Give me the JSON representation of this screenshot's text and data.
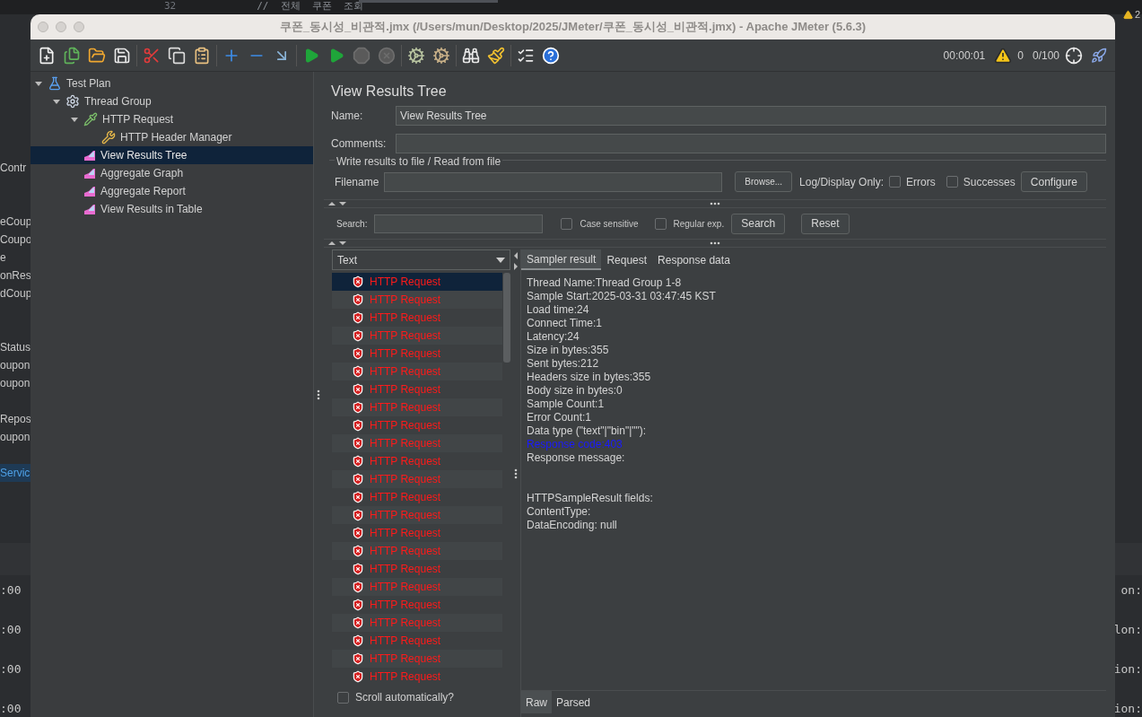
{
  "background_editor": {
    "line_number": "32",
    "code_line": "//  전체  쿠폰  조회",
    "problem_count": "2",
    "left_fragments": [
      {
        "text": "Contr",
        "selected": false
      },
      {
        "text": "eCoup",
        "selected": false
      },
      {
        "text": "Coupo",
        "selected": false
      },
      {
        "text": "e",
        "selected": false
      },
      {
        "text": "onRes",
        "selected": false
      },
      {
        "text": "dCoup",
        "selected": false
      },
      {
        "text": "Status",
        "selected": false
      },
      {
        "text": "oupon",
        "selected": false
      },
      {
        "text": "oupon",
        "selected": false
      },
      {
        "text": "Repos",
        "selected": false
      },
      {
        "text": "oupon",
        "selected": false
      },
      {
        "text": "Servic",
        "selected": true
      }
    ],
    "bottom_left_fragments": [
      ":00",
      ":00",
      ":00",
      ":00"
    ],
    "bottom_right_fragments": [
      "on:",
      "lon:",
      "ion:",
      "ion:"
    ]
  },
  "window": {
    "title": "쿠폰_동시성_비관적.jmx (/Users/mun/Desktop/2025/JMeter/쿠폰_동시성_비관적.jmx) - Apache JMeter (5.6.3)"
  },
  "toolbar": {
    "timer": "00:00:01",
    "warning_count": "0",
    "threads": "0/100"
  },
  "tree": [
    {
      "label": "Test Plan",
      "kind": "plan",
      "expanded": true,
      "selected": false,
      "children": [
        {
          "label": "Thread Group",
          "kind": "thread-group",
          "expanded": true,
          "selected": false,
          "children": [
            {
              "label": "HTTP Request",
              "kind": "sampler",
              "expanded": true,
              "selected": false,
              "children": [
                {
                  "label": "HTTP Header Manager",
                  "kind": "config",
                  "selected": false
                }
              ]
            },
            {
              "label": "View Results Tree",
              "kind": "listener",
              "selected": true
            },
            {
              "label": "Aggregate Graph",
              "kind": "listener",
              "selected": false
            },
            {
              "label": "Aggregate Report",
              "kind": "listener",
              "selected": false
            },
            {
              "label": "View Results in Table",
              "kind": "listener",
              "selected": false
            }
          ]
        }
      ]
    }
  ],
  "panel": {
    "title": "View Results Tree",
    "name_label": "Name:",
    "name_value": "View Results Tree",
    "comments_label": "Comments:",
    "file_group": {
      "legend": "Write results to file / Read from file",
      "filename_label": "Filename",
      "browse": "Browse...",
      "log_label": "Log/Display Only:",
      "errors": {
        "label": "Errors",
        "checked": false
      },
      "successes": {
        "label": "Successes",
        "checked": false
      },
      "configure": "Configure"
    },
    "search": {
      "label": "Search:",
      "case_sensitive": {
        "label": "Case sensitive",
        "checked": false
      },
      "regex": {
        "label": "Regular exp.",
        "checked": false
      },
      "search_button": "Search",
      "reset_button": "Reset"
    },
    "renderer": "Text",
    "results": [
      {
        "label": "HTTP Request",
        "kind": "error",
        "selected": true
      },
      {
        "label": "HTTP Request",
        "kind": "error",
        "selected": false
      },
      {
        "label": "HTTP Request",
        "kind": "error",
        "selected": false
      },
      {
        "label": "HTTP Request",
        "kind": "error",
        "selected": false
      },
      {
        "label": "HTTP Request",
        "kind": "error",
        "selected": false
      },
      {
        "label": "HTTP Request",
        "kind": "error",
        "selected": false
      },
      {
        "label": "HTTP Request",
        "kind": "error",
        "selected": false
      },
      {
        "label": "HTTP Request",
        "kind": "error",
        "selected": false
      },
      {
        "label": "HTTP Request",
        "kind": "error",
        "selected": false
      },
      {
        "label": "HTTP Request",
        "kind": "error",
        "selected": false
      },
      {
        "label": "HTTP Request",
        "kind": "error",
        "selected": false
      },
      {
        "label": "HTTP Request",
        "kind": "error",
        "selected": false
      },
      {
        "label": "HTTP Request",
        "kind": "error",
        "selected": false
      },
      {
        "label": "HTTP Request",
        "kind": "error",
        "selected": false
      },
      {
        "label": "HTTP Request",
        "kind": "error",
        "selected": false
      },
      {
        "label": "HTTP Request",
        "kind": "error",
        "selected": false
      },
      {
        "label": "HTTP Request",
        "kind": "error",
        "selected": false
      },
      {
        "label": "HTTP Request",
        "kind": "error",
        "selected": false
      },
      {
        "label": "HTTP Request",
        "kind": "error",
        "selected": false
      },
      {
        "label": "HTTP Request",
        "kind": "error",
        "selected": false
      },
      {
        "label": "HTTP Request",
        "kind": "error",
        "selected": false
      },
      {
        "label": "HTTP Request",
        "kind": "error",
        "selected": false
      },
      {
        "label": "HTTP Request",
        "kind": "error",
        "selected": false
      }
    ],
    "scroll_auto": {
      "label": "Scroll automatically?",
      "checked": false
    },
    "tabs": [
      {
        "label": "Sampler result",
        "selected": true
      },
      {
        "label": "Request",
        "selected": false
      },
      {
        "label": "Response data",
        "selected": false
      }
    ],
    "result_lines": [
      {
        "text": "Thread Name:Thread Group 1-8",
        "kind": "plain"
      },
      {
        "text": "Sample Start:2025-03-31 03:47:45 KST",
        "kind": "plain"
      },
      {
        "text": "Load time:24",
        "kind": "plain"
      },
      {
        "text": "Connect Time:1",
        "kind": "plain"
      },
      {
        "text": "Latency:24",
        "kind": "plain"
      },
      {
        "text": "Size in bytes:355",
        "kind": "plain"
      },
      {
        "text": "Sent bytes:212",
        "kind": "plain"
      },
      {
        "text": "Headers size in bytes:355",
        "kind": "plain"
      },
      {
        "text": "Body size in bytes:0",
        "kind": "plain"
      },
      {
        "text": "Sample Count:1",
        "kind": "plain"
      },
      {
        "text": "Error Count:1",
        "kind": "plain"
      },
      {
        "text": "Data type (\"text\"|\"bin\"|\"\"):",
        "kind": "plain"
      },
      {
        "text": "Response code:403",
        "kind": "link"
      },
      {
        "text": "Response message:",
        "kind": "plain"
      },
      {
        "text": "HTTPSampleResult fields:",
        "kind": "section"
      },
      {
        "text": "ContentType:",
        "kind": "plain"
      },
      {
        "text": "DataEncoding: null",
        "kind": "plain"
      }
    ],
    "bottom_tabs": [
      {
        "label": "Raw",
        "selected": true
      },
      {
        "label": "Parsed",
        "selected": false
      }
    ]
  }
}
